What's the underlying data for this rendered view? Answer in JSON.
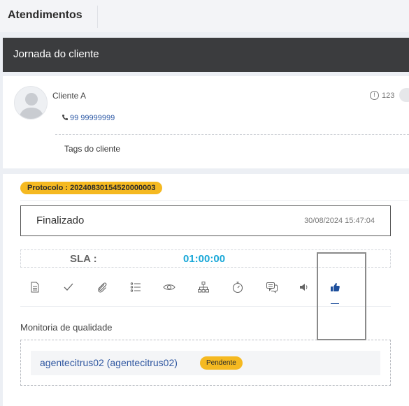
{
  "header": {
    "title": "Atendimentos"
  },
  "journey": {
    "title": "Jornada do cliente"
  },
  "client": {
    "name": "Cliente A",
    "phone": "99 99999999",
    "id": "123",
    "tags_label": "Tags do cliente"
  },
  "protocol": {
    "label": "Protocolo : 20240830154520000003"
  },
  "status": {
    "text": "Finalizado",
    "datetime": "30/08/2024 15:47:04"
  },
  "sla": {
    "label": "SLA :",
    "value": "01:00:00"
  },
  "toolbar": {
    "icons": [
      "document-icon",
      "check-icon",
      "paperclip-icon",
      "list-icon",
      "eye-icon",
      "sitemap-icon",
      "timer-icon",
      "chat-icon",
      "volume-icon",
      "thumbs-up-icon"
    ],
    "active": "thumbs-up-icon"
  },
  "quality": {
    "title": "Monitoria de qualidade",
    "agent": "agentecitrus02 (agentecitrus02)",
    "status": "Pendente"
  },
  "colors": {
    "accent": "#f5b921",
    "link": "#2e56a0",
    "sla": "#19a8d8",
    "dark_bar": "#3b3c3e"
  }
}
